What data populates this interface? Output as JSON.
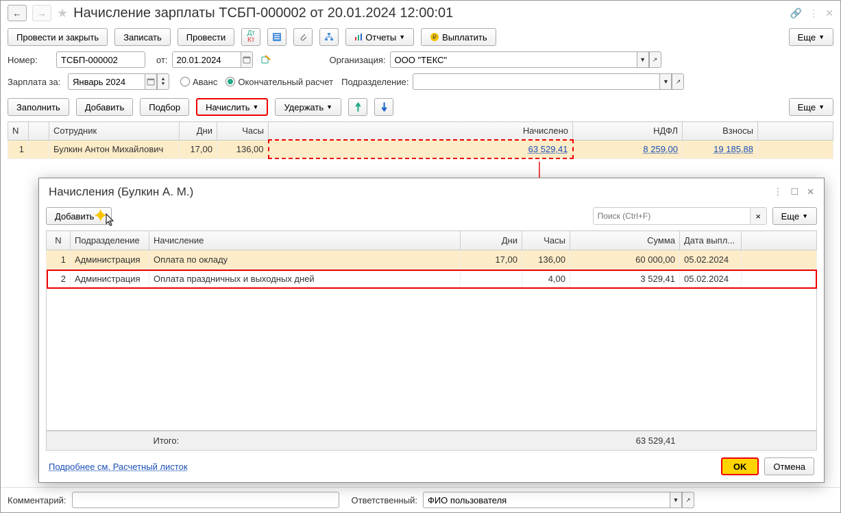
{
  "title": "Начисление зарплаты ТСБП-000002 от 20.01.2024 12:00:01",
  "toolbar": {
    "post_close": "Провести и закрыть",
    "save": "Записать",
    "post": "Провести",
    "reports": "Отчеты",
    "pay": "Выплатить",
    "more": "Еще"
  },
  "form1": {
    "number_label": "Номер:",
    "number": "ТСБП-000002",
    "from_label": "от:",
    "date": "20.01.2024",
    "org_label": "Организация:",
    "org": "ООО \"ТЕКС\""
  },
  "form2": {
    "salary_for_label": "Зарплата за:",
    "salary_for": "Январь 2024",
    "advance": "Аванс",
    "final": "Окончательный расчет",
    "subdiv_label": "Подразделение:",
    "subdiv": ""
  },
  "actions": {
    "fill": "Заполнить",
    "add": "Добавить",
    "pick": "Подбор",
    "accrue": "Начислить",
    "withhold": "Удержать",
    "more": "Еще"
  },
  "main_table": {
    "headers": {
      "n": "N",
      "emp": "Сотрудник",
      "days": "Дни",
      "hours": "Часы",
      "accrued": "Начислено",
      "ndfl": "НДФЛ",
      "contrib": "Взносы"
    },
    "row": {
      "n": "1",
      "emp": "Булкин Антон Михайлович",
      "days": "17,00",
      "hours": "136,00",
      "accrued": "63 529,41",
      "ndfl": "8 259,00",
      "contrib": "19 185,88"
    }
  },
  "popup": {
    "title": "Начисления (Булкин А. М.)",
    "add": "Добавить",
    "search_ph": "Поиск (Ctrl+F)",
    "more": "Еще",
    "headers": {
      "n": "N",
      "subdiv": "Подразделение",
      "accrual": "Начисление",
      "days": "Дни",
      "hours": "Часы",
      "sum": "Сумма",
      "paydate": "Дата выпл..."
    },
    "rows": [
      {
        "n": "1",
        "subdiv": "Администрация",
        "accrual": "Оплата по окладу",
        "days": "17,00",
        "hours": "136,00",
        "sum": "60 000,00",
        "paydate": "05.02.2024"
      },
      {
        "n": "2",
        "subdiv": "Администрация",
        "accrual": "Оплата праздничных и выходных дней",
        "days": "",
        "hours": "4,00",
        "sum": "3 529,41",
        "paydate": "05.02.2024"
      }
    ],
    "total_label": "Итого:",
    "total": "63 529,41",
    "detail_link": "Подробнее см. Расчетный листок",
    "ok": "OK",
    "cancel": "Отмена"
  },
  "footer": {
    "comment_label": "Комментарий:",
    "comment": "",
    "resp_label": "Ответственный:",
    "resp": "ФИО пользователя"
  }
}
